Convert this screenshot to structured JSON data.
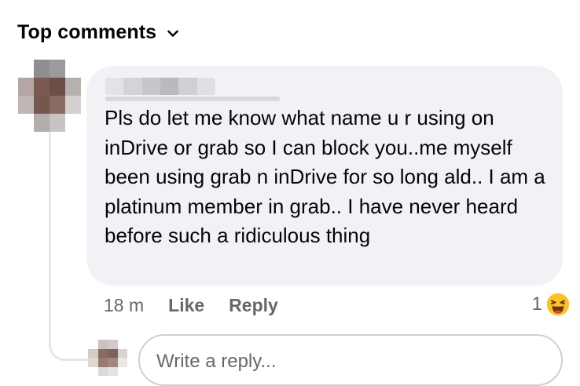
{
  "header": {
    "label": "Top comments"
  },
  "comment": {
    "text": "Pls do let me know what name u r using on inDrive or grab so I can block you..me myself been using grab n inDrive for so long ald.. I am a platinum member in grab.. I have never heard before such a ridiculous thing",
    "time": "18 m",
    "like_label": "Like",
    "reply_label": "Reply",
    "reaction_count": "1",
    "reaction_icon": "laughing-emoji-icon"
  },
  "reply_box": {
    "placeholder": "Write a reply..."
  },
  "colors": {
    "bubble_bg": "#f0f2f5",
    "secondary_text": "#65676b",
    "primary_text": "#050505",
    "emoji_yellow": "#fbc02d"
  }
}
